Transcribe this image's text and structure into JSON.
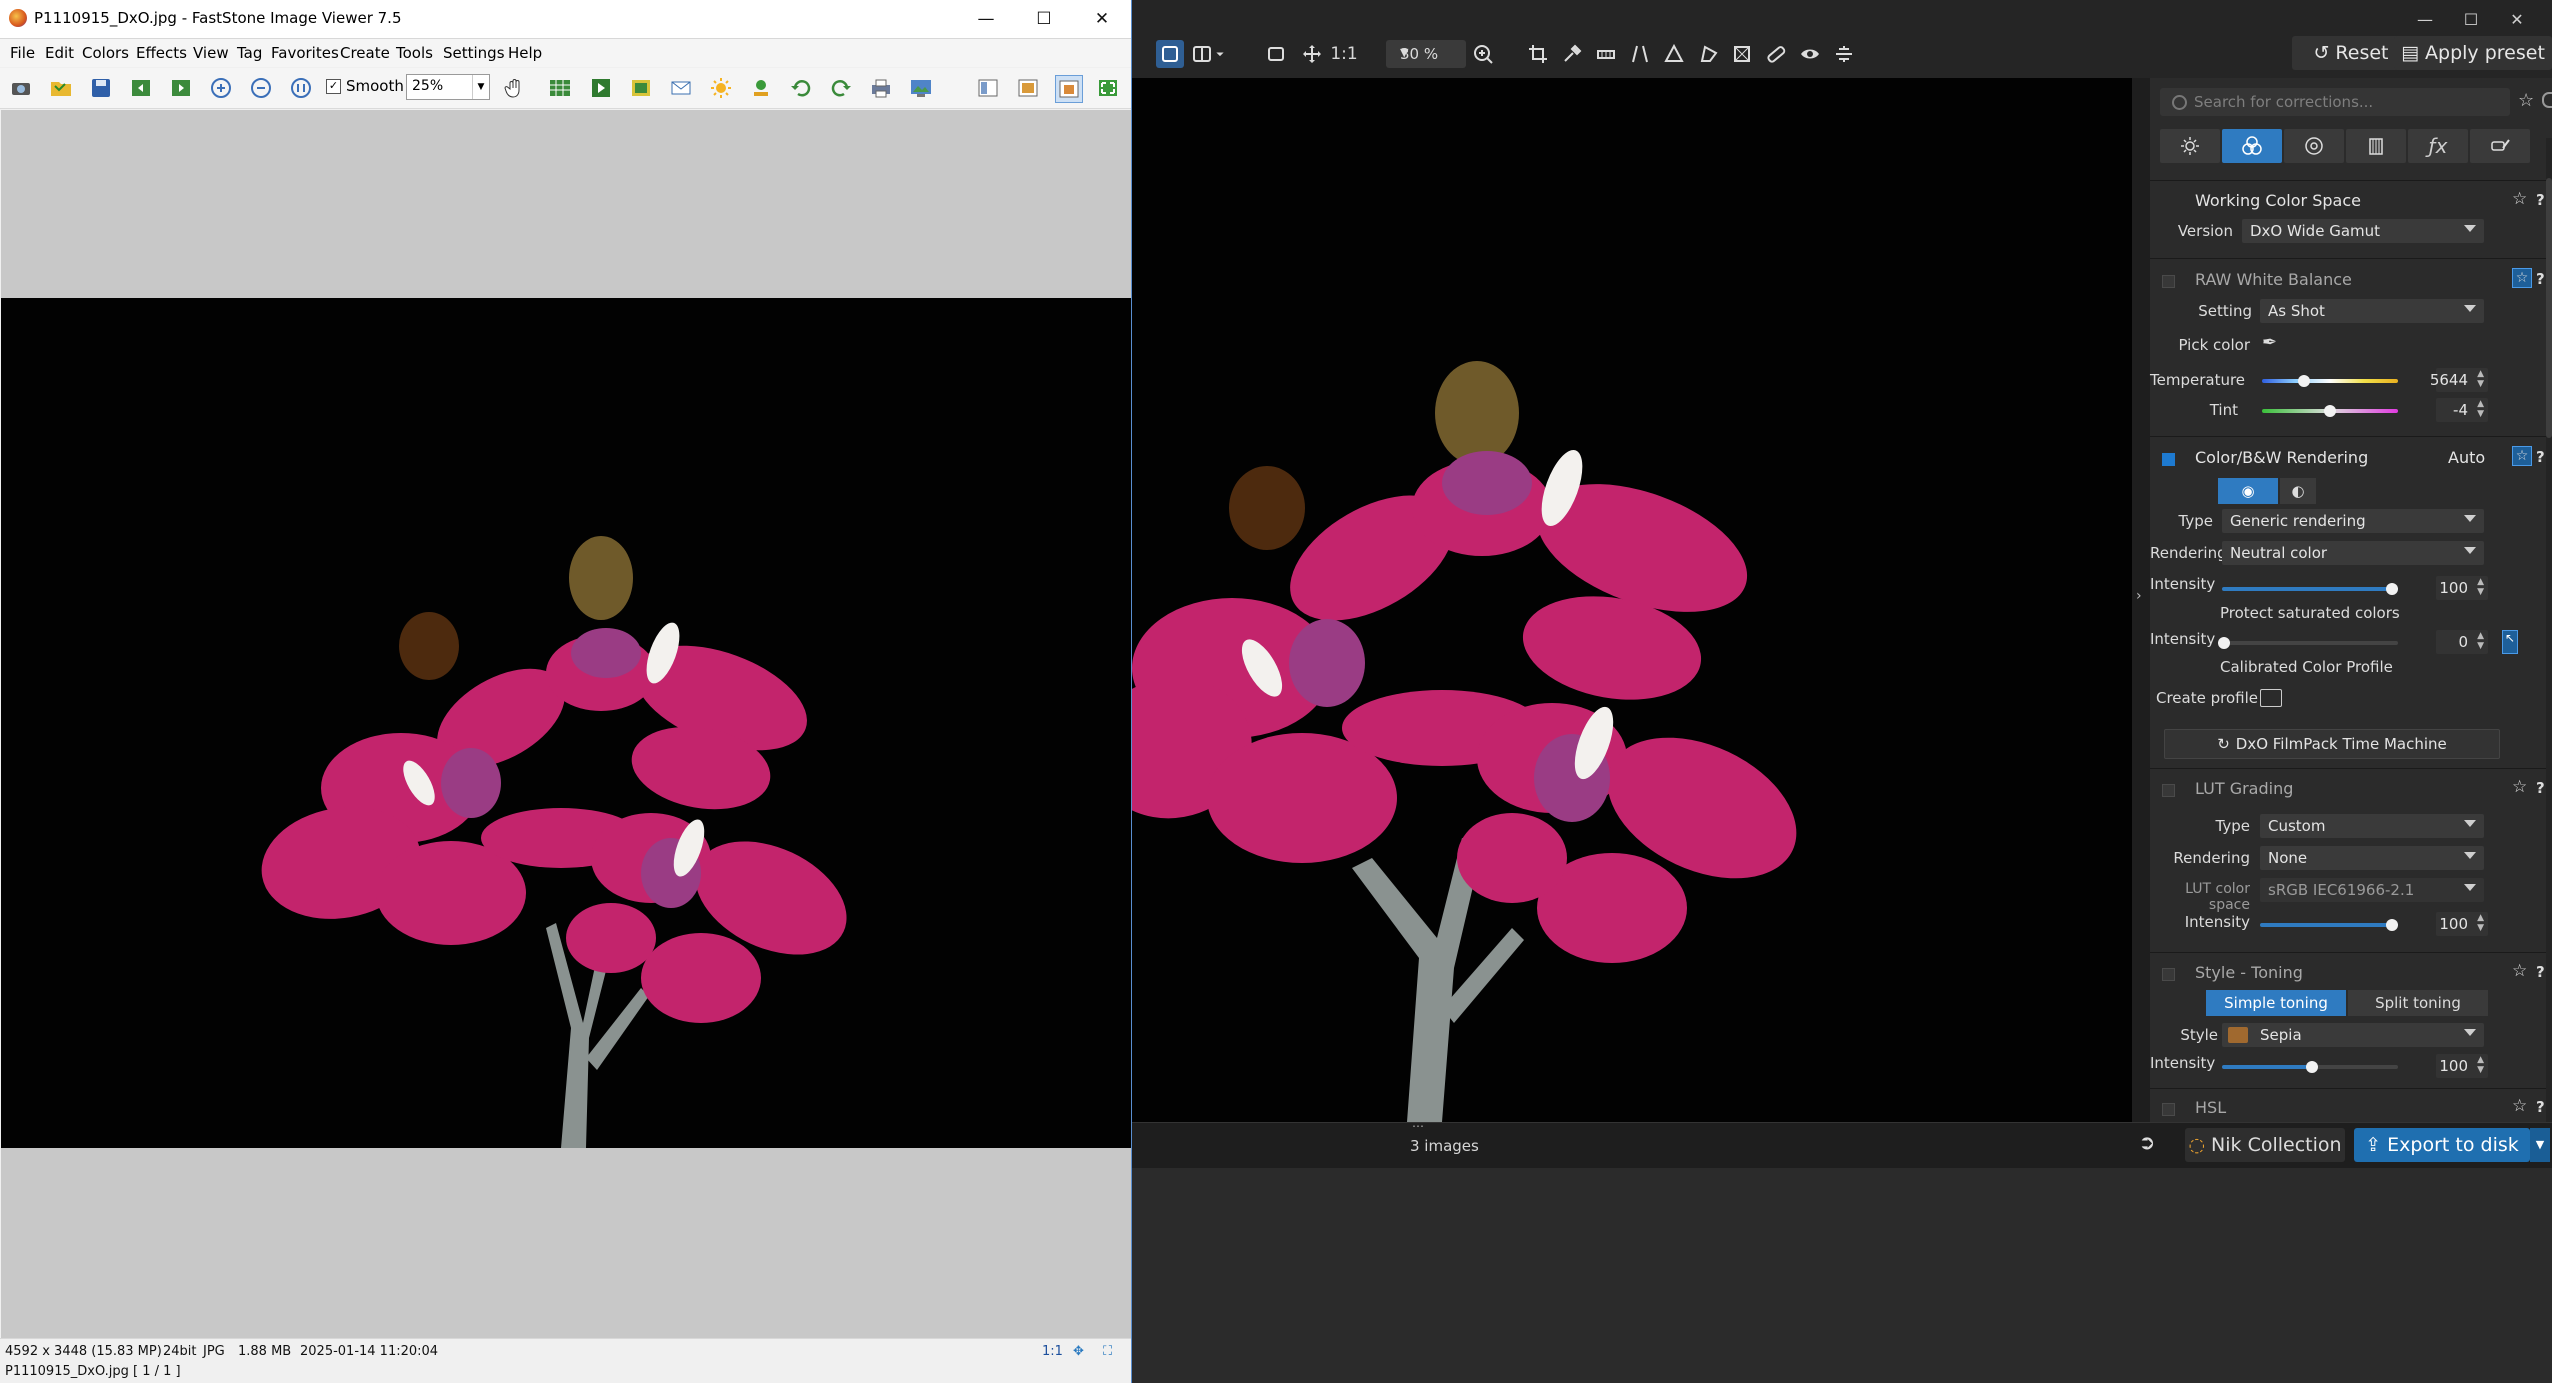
{
  "faststone": {
    "title": "P1110915_DxO.jpg  -  FastStone Image Viewer 7.5",
    "menu": [
      "File",
      "Edit",
      "Colors",
      "Effects",
      "View",
      "Tag",
      "Favorites",
      "Create",
      "Tools",
      "Settings",
      "Help"
    ],
    "smooth_label": "Smooth",
    "smooth_checked": true,
    "zoom_value": "25%",
    "status": {
      "dimensions": "4592 x 3448 (15.83 MP)",
      "bitdepth": "24bit",
      "format": "JPG",
      "filesize": "1.88 MB",
      "datetime": "2025-01-14 11:20:04",
      "ratio": "1:1"
    },
    "filename_status": "P1110915_DxO.jpg [ 1 / 1 ]",
    "window_controls": {
      "minimize": "—",
      "maximize": "☐",
      "close": "✕"
    }
  },
  "dxo": {
    "window_controls": {
      "minimize": "—",
      "maximize": "☐",
      "close": "✕"
    },
    "toolbar": {
      "ratio_label": "1:1",
      "zoom_value": "30 %",
      "reset_label": "Reset",
      "apply_preset_label": "Apply preset"
    },
    "search_placeholder": "Search for corrections...",
    "footer": {
      "images_count": "3 images",
      "nik_label": "Nik Collection",
      "export_label": "Export to disk"
    },
    "panel": {
      "working_color_space": {
        "title": "Working Color Space",
        "version_label": "Version",
        "version_value": "DxO Wide Gamut"
      },
      "raw_white_balance": {
        "title": "RAW White Balance",
        "setting_label": "Setting",
        "setting_value": "As Shot",
        "pick_color_label": "Pick color",
        "temperature_label": "Temperature",
        "temperature_value": "5644",
        "tint_label": "Tint",
        "tint_value": "-4"
      },
      "color_bw_rendering": {
        "title": "Color/B&W Rendering",
        "auto_label": "Auto",
        "type_label": "Type",
        "type_value": "Generic rendering",
        "rendering_label": "Rendering",
        "rendering_value": "Neutral color",
        "intensity_label": "Intensity",
        "intensity_value": "100",
        "protect_label": "Protect saturated colors",
        "protect_intensity_label": "Intensity",
        "protect_intensity_value": "0",
        "calibrated_label": "Calibrated Color Profile",
        "create_profile_label": "Create profile",
        "filmpack_label": "DxO FilmPack Time Machine"
      },
      "lut_grading": {
        "title": "LUT Grading",
        "type_label": "Type",
        "type_value": "Custom",
        "rendering_label": "Rendering",
        "rendering_value": "None",
        "lut_space_label": "LUT color space",
        "lut_space_value": "sRGB IEC61966-2.1",
        "intensity_label": "Intensity",
        "intensity_value": "100"
      },
      "style_toning": {
        "title": "Style - Toning",
        "simple_label": "Simple toning",
        "split_label": "Split toning",
        "style_label": "Style",
        "style_value": "Sepia",
        "style_swatch": "#a0692f",
        "intensity_label": "Intensity",
        "intensity_value": "100"
      },
      "hsl": {
        "title": "HSL"
      }
    }
  },
  "colors": {
    "accent_blue": "#2f7bc1",
    "petal": "#c42d74"
  }
}
